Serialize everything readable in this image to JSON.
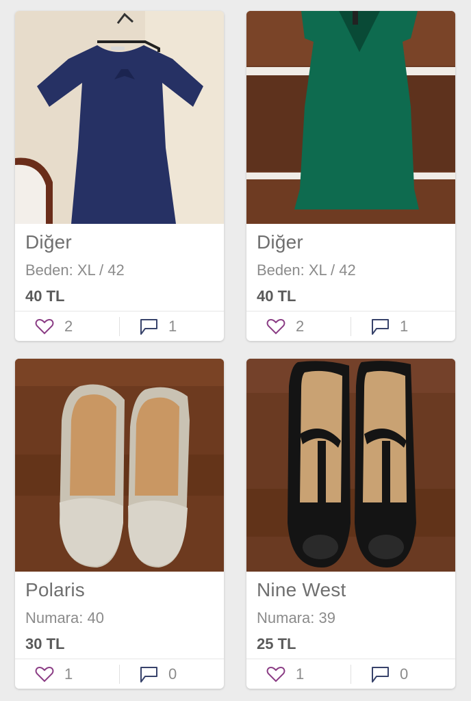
{
  "accent_color": "#8a3c84",
  "products": [
    {
      "brand": "Diğer",
      "size_label": "Beden: XL / 42",
      "price": "40 TL",
      "likes": "2",
      "comments": "1",
      "image": "navy-dress-photo"
    },
    {
      "brand": "Diğer",
      "size_label": "Beden: XL / 42",
      "price": "40 TL",
      "likes": "2",
      "comments": "1",
      "image": "green-dress-photo"
    },
    {
      "brand": "Polaris",
      "size_label": "Numara: 40",
      "price": "30 TL",
      "likes": "1",
      "comments": "0",
      "image": "beige-loafers-photo"
    },
    {
      "brand": "Nine West",
      "size_label": "Numara: 39",
      "price": "25 TL",
      "likes": "1",
      "comments": "0",
      "image": "black-heels-photo"
    }
  ]
}
